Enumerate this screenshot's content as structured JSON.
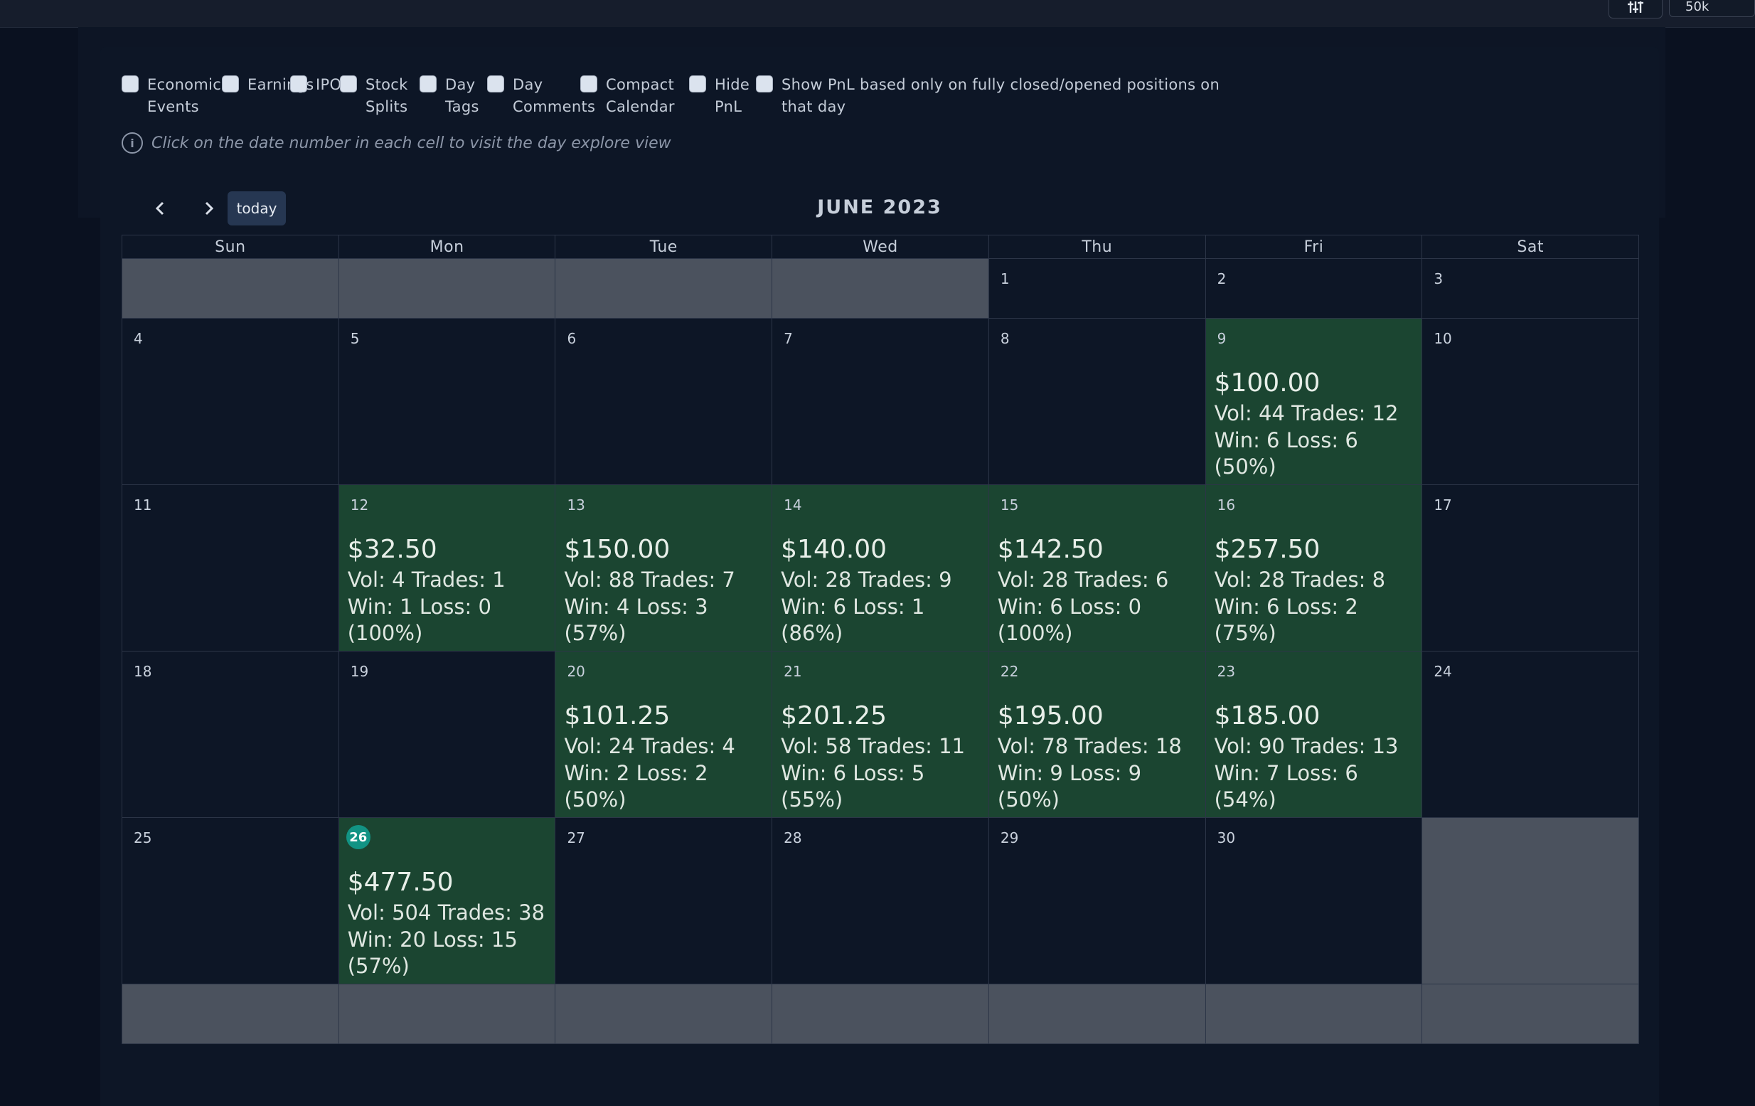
{
  "topbar": {
    "filter_icon": "sliders-icon",
    "size_label": "50k"
  },
  "options": [
    {
      "label": "Economic\nEvents",
      "checked": false
    },
    {
      "label": "Earnings",
      "checked": false
    },
    {
      "label": "IPOs",
      "checked": false
    },
    {
      "label": "Stock\nSplits",
      "checked": false
    },
    {
      "label": "Day\nTags",
      "checked": false
    },
    {
      "label": "Day\nComments",
      "checked": false
    },
    {
      "label": "Compact\nCalendar",
      "checked": false
    },
    {
      "label": "Hide\nPnL",
      "checked": false
    },
    {
      "label": "Show PnL based only on fully closed/opened positions on\nthat day",
      "checked": false
    }
  ],
  "hint": "Click on the date number in each cell to visit the day explore view",
  "nav": {
    "prev_icon": "chevron-left-icon",
    "next_icon": "chevron-right-icon",
    "today_label": "today"
  },
  "calendar": {
    "title": "JUNE 2023",
    "weekdays": [
      "Sun",
      "Mon",
      "Tue",
      "Wed",
      "Thu",
      "Fri",
      "Sat"
    ],
    "today_day": 26,
    "colors": {
      "profit": "#1b4531",
      "today": "#129384",
      "other_month": "#4b525e"
    },
    "weeks": [
      [
        null,
        null,
        null,
        null,
        {
          "day": 1
        },
        {
          "day": 2
        },
        {
          "day": 3
        }
      ],
      [
        {
          "day": 4
        },
        {
          "day": 5
        },
        {
          "day": 6
        },
        {
          "day": 7
        },
        {
          "day": 8
        },
        {
          "day": 9,
          "pnl": "$100.00",
          "vol": "Vol: 44 Trades: 12",
          "wl": "Win: 6 Loss: 6",
          "pct": "(50%)"
        },
        {
          "day": 10
        }
      ],
      [
        {
          "day": 11
        },
        {
          "day": 12,
          "pnl": "$32.50",
          "vol": "Vol: 4 Trades: 1",
          "wl": "Win: 1 Loss: 0",
          "pct": "(100%)"
        },
        {
          "day": 13,
          "pnl": "$150.00",
          "vol": "Vol: 88 Trades: 7",
          "wl": "Win: 4 Loss: 3",
          "pct": "(57%)"
        },
        {
          "day": 14,
          "pnl": "$140.00",
          "vol": "Vol: 28 Trades: 9",
          "wl": "Win: 6 Loss: 1",
          "pct": "(86%)"
        },
        {
          "day": 15,
          "pnl": "$142.50",
          "vol": "Vol: 28 Trades: 6",
          "wl": "Win: 6 Loss: 0",
          "pct": "(100%)"
        },
        {
          "day": 16,
          "pnl": "$257.50",
          "vol": "Vol: 28 Trades: 8",
          "wl": "Win: 6 Loss: 2",
          "pct": "(75%)"
        },
        {
          "day": 17
        }
      ],
      [
        {
          "day": 18
        },
        {
          "day": 19
        },
        {
          "day": 20,
          "pnl": "$101.25",
          "vol": "Vol: 24 Trades: 4",
          "wl": "Win: 2 Loss: 2",
          "pct": "(50%)"
        },
        {
          "day": 21,
          "pnl": "$201.25",
          "vol": "Vol: 58 Trades: 11",
          "wl": "Win: 6 Loss: 5",
          "pct": "(55%)"
        },
        {
          "day": 22,
          "pnl": "$195.00",
          "vol": "Vol: 78 Trades: 18",
          "wl": "Win: 9 Loss: 9",
          "pct": "(50%)"
        },
        {
          "day": 23,
          "pnl": "$185.00",
          "vol": "Vol: 90 Trades: 13",
          "wl": "Win: 7 Loss: 6",
          "pct": "(54%)"
        },
        {
          "day": 24
        }
      ],
      [
        {
          "day": 25
        },
        {
          "day": 26,
          "pnl": "$477.50",
          "vol": "Vol: 504 Trades: 38",
          "wl": "Win: 20 Loss: 15",
          "pct": "(57%)"
        },
        {
          "day": 27
        },
        {
          "day": 28
        },
        {
          "day": 29
        },
        {
          "day": 30
        },
        null
      ],
      [
        null,
        null,
        null,
        null,
        null,
        null,
        null
      ]
    ]
  }
}
